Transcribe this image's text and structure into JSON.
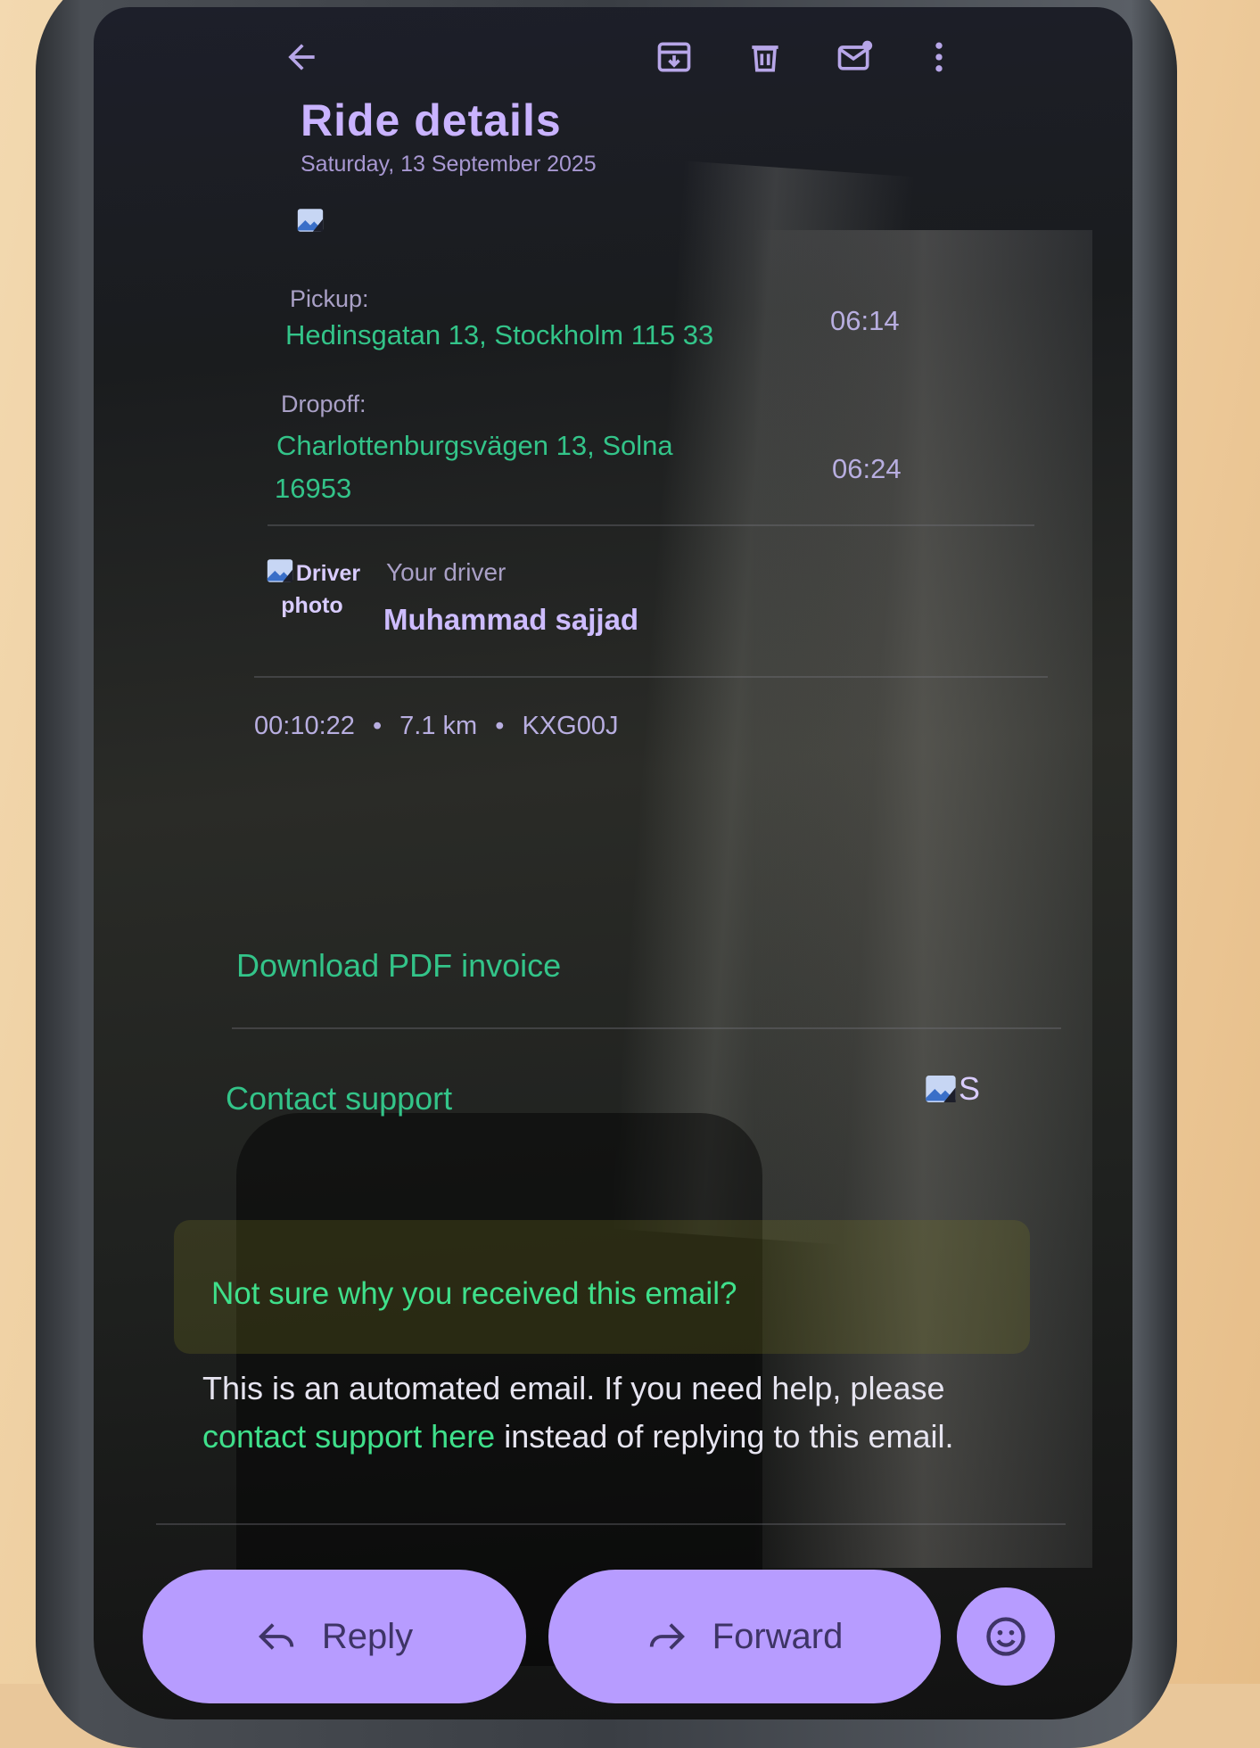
{
  "toolbar": {
    "back_icon": "back-arrow-icon",
    "archive_icon": "archive-icon",
    "delete_icon": "delete-icon",
    "unread_icon": "mark-unread-icon",
    "more_icon": "more-vertical-icon"
  },
  "email": {
    "title": "Ride details",
    "date": "Saturday, 13 September 2025",
    "pickup": {
      "label": "Pickup:",
      "address": "Hedinsgatan 13, Stockholm 115 33",
      "time": "06:14"
    },
    "dropoff": {
      "label": "Dropoff:",
      "address_line1": "Charlottenburgsvägen 13, Solna",
      "address_line2": "16953",
      "time": "06:24"
    },
    "driver": {
      "photo_alt": "Driver photo",
      "label": "Your driver",
      "name": "Muhammad sajjad"
    },
    "trip": {
      "duration": "00:10:22",
      "distance": "7.1 km",
      "plate": "KXG00J",
      "separator": "•"
    },
    "links": {
      "download_invoice": "Download PDF invoice",
      "contact_support": "Contact support",
      "support_img_alt": "S"
    },
    "faq": {
      "question": "Not sure why you received this email?",
      "answer_part1": "This is an automated email. If you need help, please",
      "answer_link": "contact support here",
      "answer_part2": "instead of replying to this email."
    }
  },
  "actions": {
    "reply_label": "Reply",
    "forward_label": "Forward",
    "emoji_icon": "emoji-smile-icon"
  },
  "colors": {
    "accent_purple": "#b79cff",
    "link_green": "#33c489",
    "screen_bg": "#1a1c1e"
  }
}
